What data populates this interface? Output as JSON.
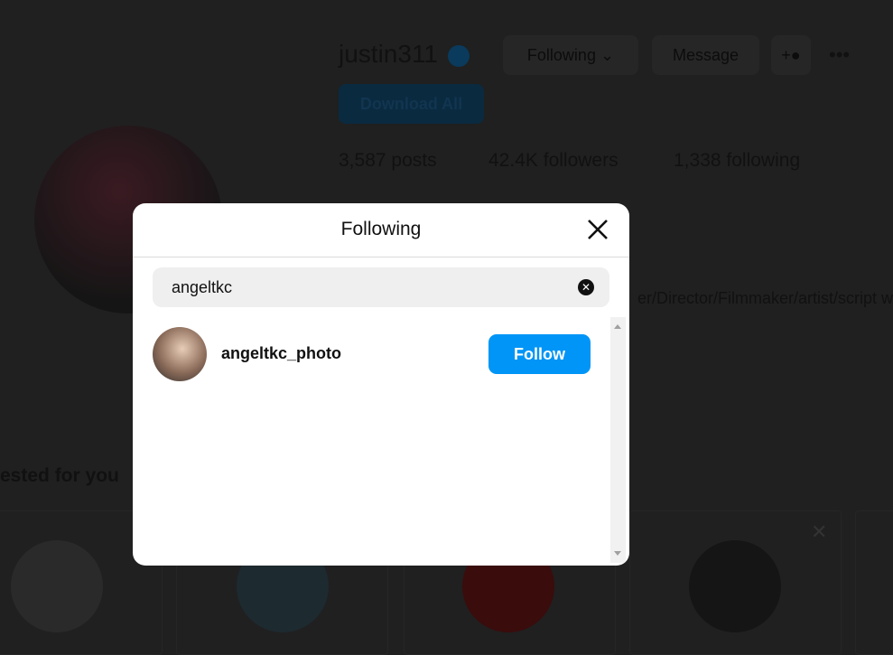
{
  "profile": {
    "username": "justin311",
    "following_button": "Following",
    "message_button": "Message",
    "download_all": "Download All",
    "posts_count": "3,587",
    "posts_label": "posts",
    "followers_count": "42.4K",
    "followers_label": "followers",
    "following_count": "1,338",
    "following_label": "following",
    "bio_fragment": "er/Director/Filmmaker/artist/script w"
  },
  "suggested": {
    "title": "ested for you"
  },
  "modal": {
    "title": "Following",
    "search_value": "angeltkc",
    "results": [
      {
        "username": "angeltkc_photo",
        "action": "Follow"
      }
    ]
  },
  "colors": {
    "accent": "#0095f6",
    "overlay": "#202020"
  }
}
